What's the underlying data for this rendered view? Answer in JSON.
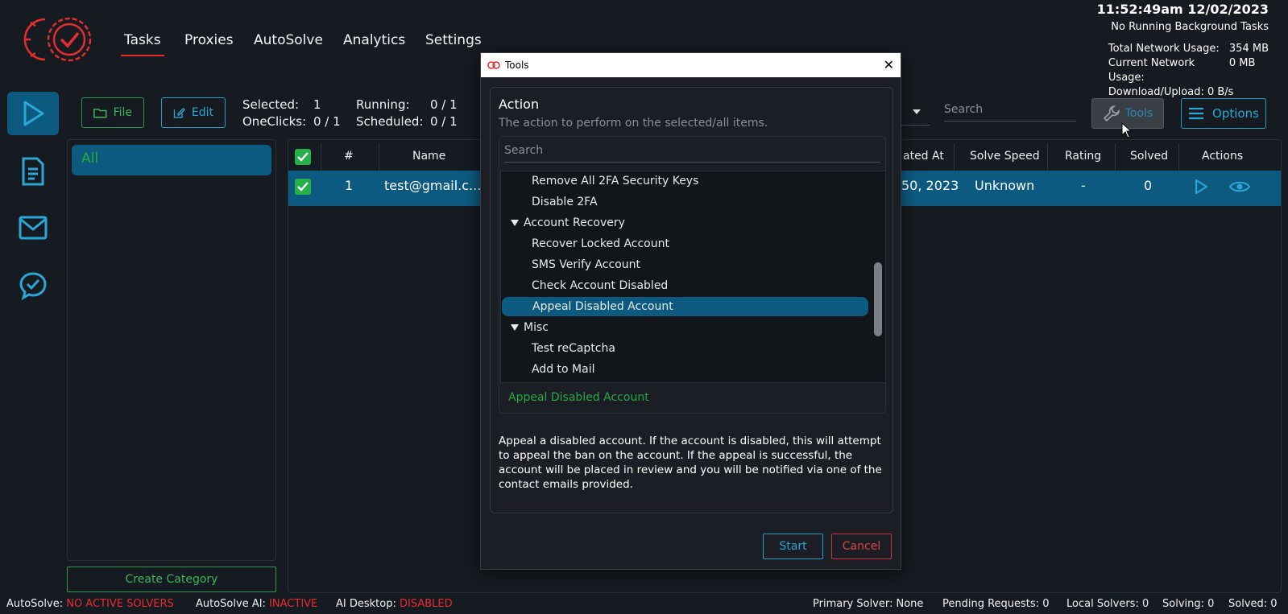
{
  "header": {
    "nav": [
      "Tasks",
      "Proxies",
      "AutoSolve",
      "Analytics",
      "Settings"
    ],
    "active_nav": "Tasks",
    "datetime": "11:52:49am 12/02/2023",
    "background_status": "No Running Background Tasks",
    "network": {
      "total_label": "Total Network Usage:",
      "total_value": "354 MB",
      "current_label": "Current Network Usage:",
      "current_value": "0 MB",
      "download_upload": "Download/Upload: 0 B/s"
    }
  },
  "toolbar": {
    "file_label": "File",
    "edit_label": "Edit",
    "selected_label": "Selected:",
    "selected_value": "1",
    "running_label": "Running:",
    "running_value": "0 / 1",
    "oneclicks_label": "OneClicks:",
    "oneclicks_value": "0 / 1",
    "scheduled_label": "Scheduled:",
    "scheduled_value": "0 / 1",
    "search_placeholder": "Search",
    "tools_label": "Tools",
    "options_label": "Options"
  },
  "categories": {
    "items": [
      "All"
    ],
    "create_label": "Create Category"
  },
  "table": {
    "columns": [
      "#",
      "Name",
      "ated At",
      "Solve Speed",
      "Rating",
      "Solved",
      "Actions"
    ],
    "row": {
      "num": "1",
      "name": "test@gmail.c...",
      "created": "50, 2023",
      "speed": "Unknown",
      "rating": "-",
      "solved": "0"
    }
  },
  "modal": {
    "title": "Tools",
    "action_title": "Action",
    "action_desc": "The action to perform on the selected/all items.",
    "search_placeholder": "Search",
    "list": [
      {
        "type": "item",
        "label": "Remove All 2FA Security Keys"
      },
      {
        "type": "item",
        "label": "Disable 2FA"
      },
      {
        "type": "group",
        "label": "Account Recovery"
      },
      {
        "type": "item",
        "label": "Recover Locked Account"
      },
      {
        "type": "item",
        "label": "SMS Verify Account"
      },
      {
        "type": "item",
        "label": "Check Account Disabled"
      },
      {
        "type": "item",
        "label": "Appeal Disabled Account",
        "selected": true
      },
      {
        "type": "group",
        "label": "Misc"
      },
      {
        "type": "item",
        "label": "Test reCaptcha"
      },
      {
        "type": "item",
        "label": "Add to Mail"
      }
    ],
    "selected_action": "Appeal Disabled Account",
    "description": "Appeal a disabled account. If the account is disabled, this will attempt to appeal the ban on the account. If the appeal is successful, the account will be placed in review and you will be notified via one of the contact emails provided.",
    "start_label": "Start",
    "cancel_label": "Cancel"
  },
  "statusbar": {
    "autosolve_label": "AutoSolve:",
    "autosolve_value": "NO ACTIVE SOLVERS",
    "ai_label": "AutoSolve AI:",
    "ai_value": "INACTIVE",
    "desktop_label": "AI Desktop:",
    "desktop_value": "DISABLED",
    "primary": "Primary Solver: None",
    "pending": "Pending Requests: 0",
    "local": "Local Solvers: 0",
    "solving": "Solving: 0",
    "solved": "Solved: 0"
  },
  "colors": {
    "accent_blue": "#0d5a80",
    "green": "#26a940",
    "red": "#e52d2d"
  }
}
